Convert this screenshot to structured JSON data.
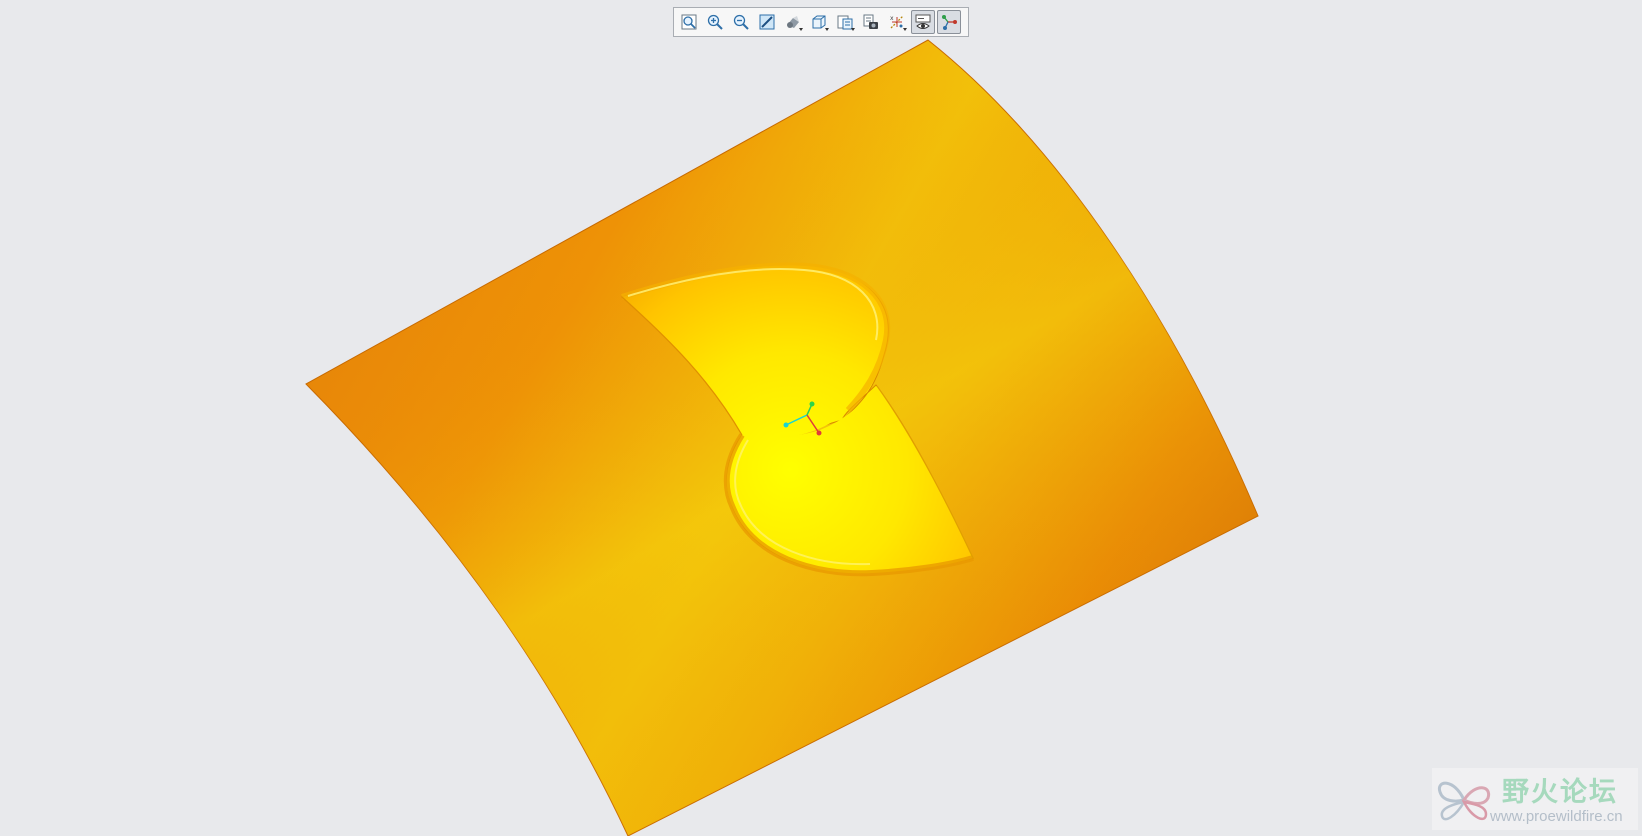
{
  "toolbar": {
    "buttons": [
      {
        "icon": "zoom-fit-icon",
        "name": "refit-button"
      },
      {
        "icon": "zoom-in-icon",
        "name": "zoom-in-button"
      },
      {
        "icon": "zoom-out-icon",
        "name": "zoom-out-button"
      },
      {
        "icon": "repaint-icon",
        "name": "repaint-button"
      },
      {
        "icon": "display-style-icon",
        "name": "display-style-button",
        "dropdown": true
      },
      {
        "icon": "saved-orientations-icon",
        "name": "saved-orientations-button",
        "dropdown": true
      },
      {
        "icon": "view-manager-icon",
        "name": "view-manager-button",
        "dropdown": true
      },
      {
        "icon": "perspective-camera-icon",
        "name": "perspective-view-button"
      },
      {
        "icon": "datum-display-filters-icon",
        "name": "datum-display-filters-button",
        "dropdown": true
      },
      {
        "icon": "annotation-display-icon",
        "name": "annotation-display-button",
        "active": true
      },
      {
        "icon": "spin-center-icon",
        "name": "spin-center-button",
        "active": true
      }
    ]
  },
  "model": {
    "colors": {
      "surface_dark": "#d9780a",
      "surface_mid": "#ef8f05",
      "surface_light": "#f2c10a",
      "inner_bright": "#ffff00",
      "inner_mid": "#ffd000",
      "edge": "#c86a00",
      "csys_x": "#e03a3a",
      "csys_y": "#2bd44a",
      "csys_z": "#17d4d4"
    }
  },
  "watermark": {
    "title": "野火论坛",
    "url": "www.proewildfire.cn",
    "title_color": "#a6d9bd",
    "url_color": "#b4bec9"
  }
}
